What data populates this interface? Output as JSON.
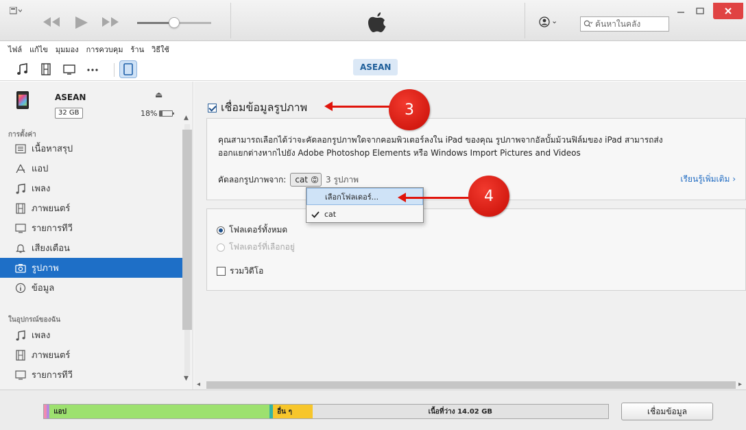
{
  "window": {
    "search_placeholder": "ค้นหาในคลัง",
    "account_chevron": "⌄"
  },
  "menu": [
    "ไฟล์",
    "แก้ไข",
    "มุมมอง",
    "การควบคุม",
    "ร้าน",
    "วิธีใช้"
  ],
  "device_pill": "ASEAN",
  "device": {
    "name": "ASEAN",
    "capacity": "32 GB",
    "battery": "18%",
    "battery_level": 0.18
  },
  "sidebar": {
    "settings_header": "การตั้งค่า",
    "settings_items": [
      {
        "label": "เนื้อหาสรุป",
        "icon": "summary-icon"
      },
      {
        "label": "แอป",
        "icon": "apps-icon"
      },
      {
        "label": "เพลง",
        "icon": "music-icon"
      },
      {
        "label": "ภาพยนตร์",
        "icon": "film-icon"
      },
      {
        "label": "รายการทีวี",
        "icon": "tv-icon"
      },
      {
        "label": "เสียงเตือน",
        "icon": "bell-icon"
      },
      {
        "label": "รูปภาพ",
        "icon": "camera-icon",
        "active": true
      },
      {
        "label": "ข้อมูล",
        "icon": "info-icon"
      }
    ],
    "ondevice_header": "ในอุปกรณ์ของฉัน",
    "ondevice_items": [
      {
        "label": "เพลง",
        "icon": "music-icon"
      },
      {
        "label": "ภาพยนตร์",
        "icon": "film-icon"
      },
      {
        "label": "รายการทีวี",
        "icon": "tv-icon"
      }
    ]
  },
  "main": {
    "sync_label": "เชื่อมข้อมูลรูปภาพ",
    "sync_checked": true,
    "description_line1": "คุณสามารถเลือกได้ว่าจะคัดลอกรูปภาพใดจากคอมพิวเตอร์ลงใน iPad ของคุณ รูปภาพจากอัลบั้มม้วนฟิล์มของ iPad สามารถส่ง",
    "description_line2": "ออกแยกต่างหากไปยัง Adobe Photoshop Elements หรือ Windows Import Pictures and Videos",
    "copy_from_label": "คัดลอกรูปภาพจาก:",
    "copy_from_value": "cat",
    "photo_count": "3 รูปภาพ",
    "learn_more": "เรียนรู้เพิ่มเติม",
    "options": {
      "all_folders": "โฟลเดอร์ทั้งหมด",
      "selected_folders": "โฟลเดอร์ที่เลือกอยู่",
      "include_videos": "รวมวิดีโอ"
    }
  },
  "dropdown": {
    "choose_folder": "เลือกโฟลเดอร์...",
    "selected_item": "cat"
  },
  "annotations": {
    "step3": "3",
    "step4": "4"
  },
  "capacity": {
    "apps_label": "แอป",
    "other_label": "อื่น ๆ",
    "free_label": "เนื้อที่ว่าง 14.02 GB",
    "segments": [
      {
        "name": "pink",
        "color": "#f08bb0",
        "fraction": 0.005
      },
      {
        "name": "purple",
        "color": "#b48ae0",
        "fraction": 0.005
      },
      {
        "name": "apps",
        "color": "#9de16f",
        "fraction": 0.39
      },
      {
        "name": "teal",
        "color": "#35b4a4",
        "fraction": 0.006
      },
      {
        "name": "other",
        "color": "#f7c62b",
        "fraction": 0.07
      },
      {
        "name": "free",
        "color": "#e2e2e2",
        "fraction": 0.524
      }
    ],
    "sync_button": "เชื่อมข้อมูล"
  }
}
